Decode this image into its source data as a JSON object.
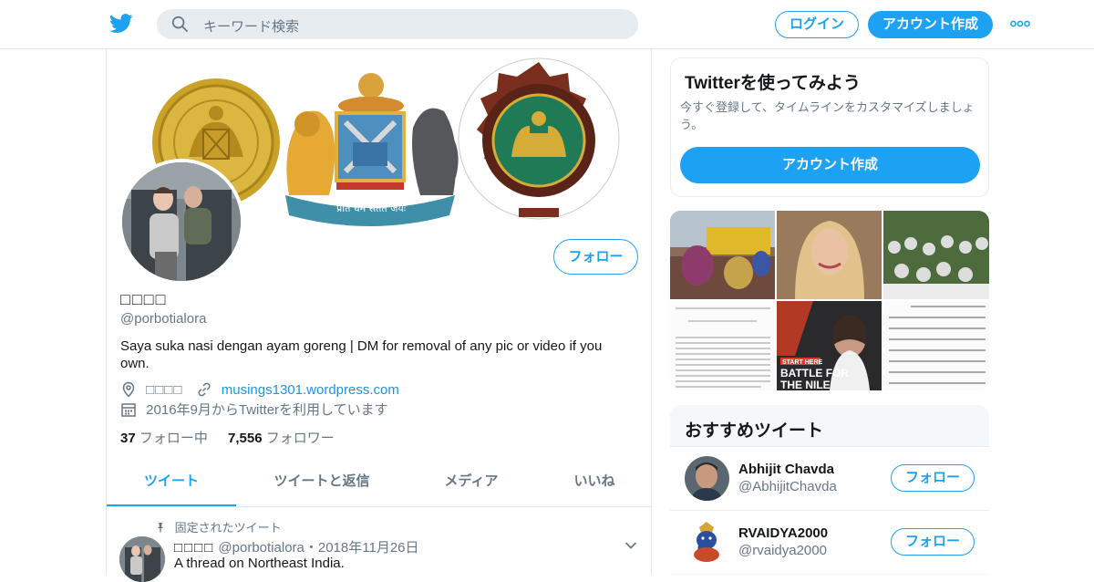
{
  "colors": {
    "accent": "#1da1f2",
    "link": "#1b95e0",
    "muted": "#657786",
    "border": "#e1e8ed"
  },
  "header": {
    "search_placeholder": "キーワード検索",
    "login_label": "ログイン",
    "signup_label": "アカウント作成",
    "icons": [
      "twitter-bird-icon",
      "search-icon",
      "more-icon"
    ]
  },
  "profile": {
    "follow_label": "フォロー",
    "name": "□□□□",
    "handle": "@porbotialora",
    "bio": "Saya suka nasi dengan ayam goreng | DM for removal of any pic or video if you own.",
    "location": "□□□□",
    "website": "musings1301.wordpress.com",
    "joined": "2016年9月からTwitterを利用しています",
    "following_count": "37",
    "following_label": "フォロー中",
    "followers_count": "7,556",
    "followers_label": "フォロワー",
    "banner_motto": "प्रति धर्मे सततं जयः"
  },
  "tabs": [
    {
      "label": "ツイート",
      "active": true
    },
    {
      "label": "ツイートと返信",
      "active": false
    },
    {
      "label": "メディア",
      "active": false
    },
    {
      "label": "いいね",
      "active": false
    }
  ],
  "pinned_tweet": {
    "pinned_label": "固定されたツイート",
    "author_name": "□□□□",
    "author_handle": "@porbotialora",
    "date": "・2018年11月26日",
    "text": "A thread on Northeast India."
  },
  "promo": {
    "title": "Twitterを使ってみよう",
    "description": "今すぐ登録して、タイムラインをカスタマイズしましょう。",
    "button_label": "アカウント作成"
  },
  "media": {
    "doc_left_caption": "...",
    "doc_right_text": "Another, better known, proposa (see Figure 1.1). In the 1920s, a pa men returned very shortly with a Andamans fuseo', which had fade and less of the place – a virgin co Snell argued in 1944 that the Anda islands are everywhere beautiful a the temperate climate, fertile land certainly have to face with much economic freedom will it not be v",
    "doc_right_link": "Figure 1.1",
    "video_tag": "START HERE",
    "video_title_1": "BATTLE FOR",
    "video_title_2": "THE NILE"
  },
  "who_to_follow": {
    "title": "おすすめツイート",
    "users": [
      {
        "name": "Abhijit Chavda",
        "handle": "@AbhijitChavda",
        "follow_label": "フォロー"
      },
      {
        "name": "RVAIDYA2000",
        "handle": "@rvaidya2000",
        "follow_label": "フォロー"
      }
    ]
  }
}
